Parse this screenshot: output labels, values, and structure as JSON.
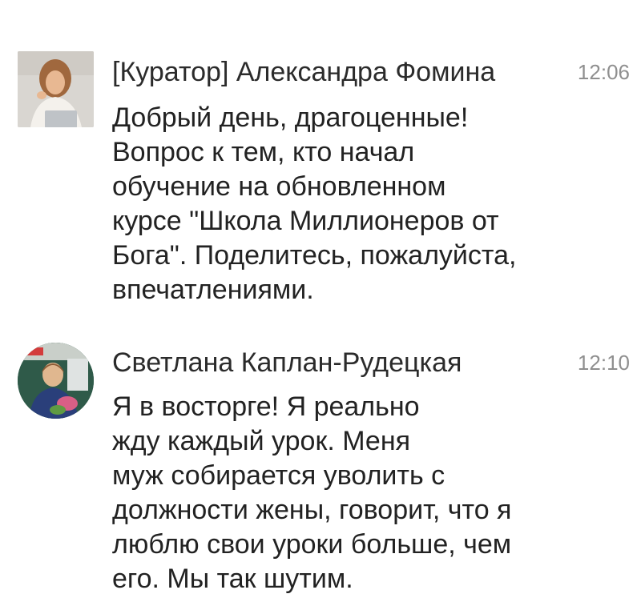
{
  "messages": [
    {
      "author": "[Куратор] Александра Фомина",
      "time": "12:06",
      "text": "Добрый день, драгоценные!\nВопрос к тем, кто начал\nобучение на обновленном\nкурсе \"Школа Миллионеров от\nБога\". Поделитесь, пожалуйста,\nвпечатлениями.",
      "avatar": "woman-with-laptop-photo"
    },
    {
      "author": "Светлана Каплан-Рудецкая",
      "time": "12:10",
      "text": "Я в восторге! Я реально\nжду каждый урок. Меня\nмуж собирается уволить с\nдолжности жены, говорит, что я\nлюблю свои уроки больше, чем\nего. Мы так шутим.",
      "avatar": "woman-with-flowers-photo"
    }
  ],
  "colors": {
    "text": "#222222",
    "time": "#8f8f8f",
    "background": "#ffffff"
  }
}
